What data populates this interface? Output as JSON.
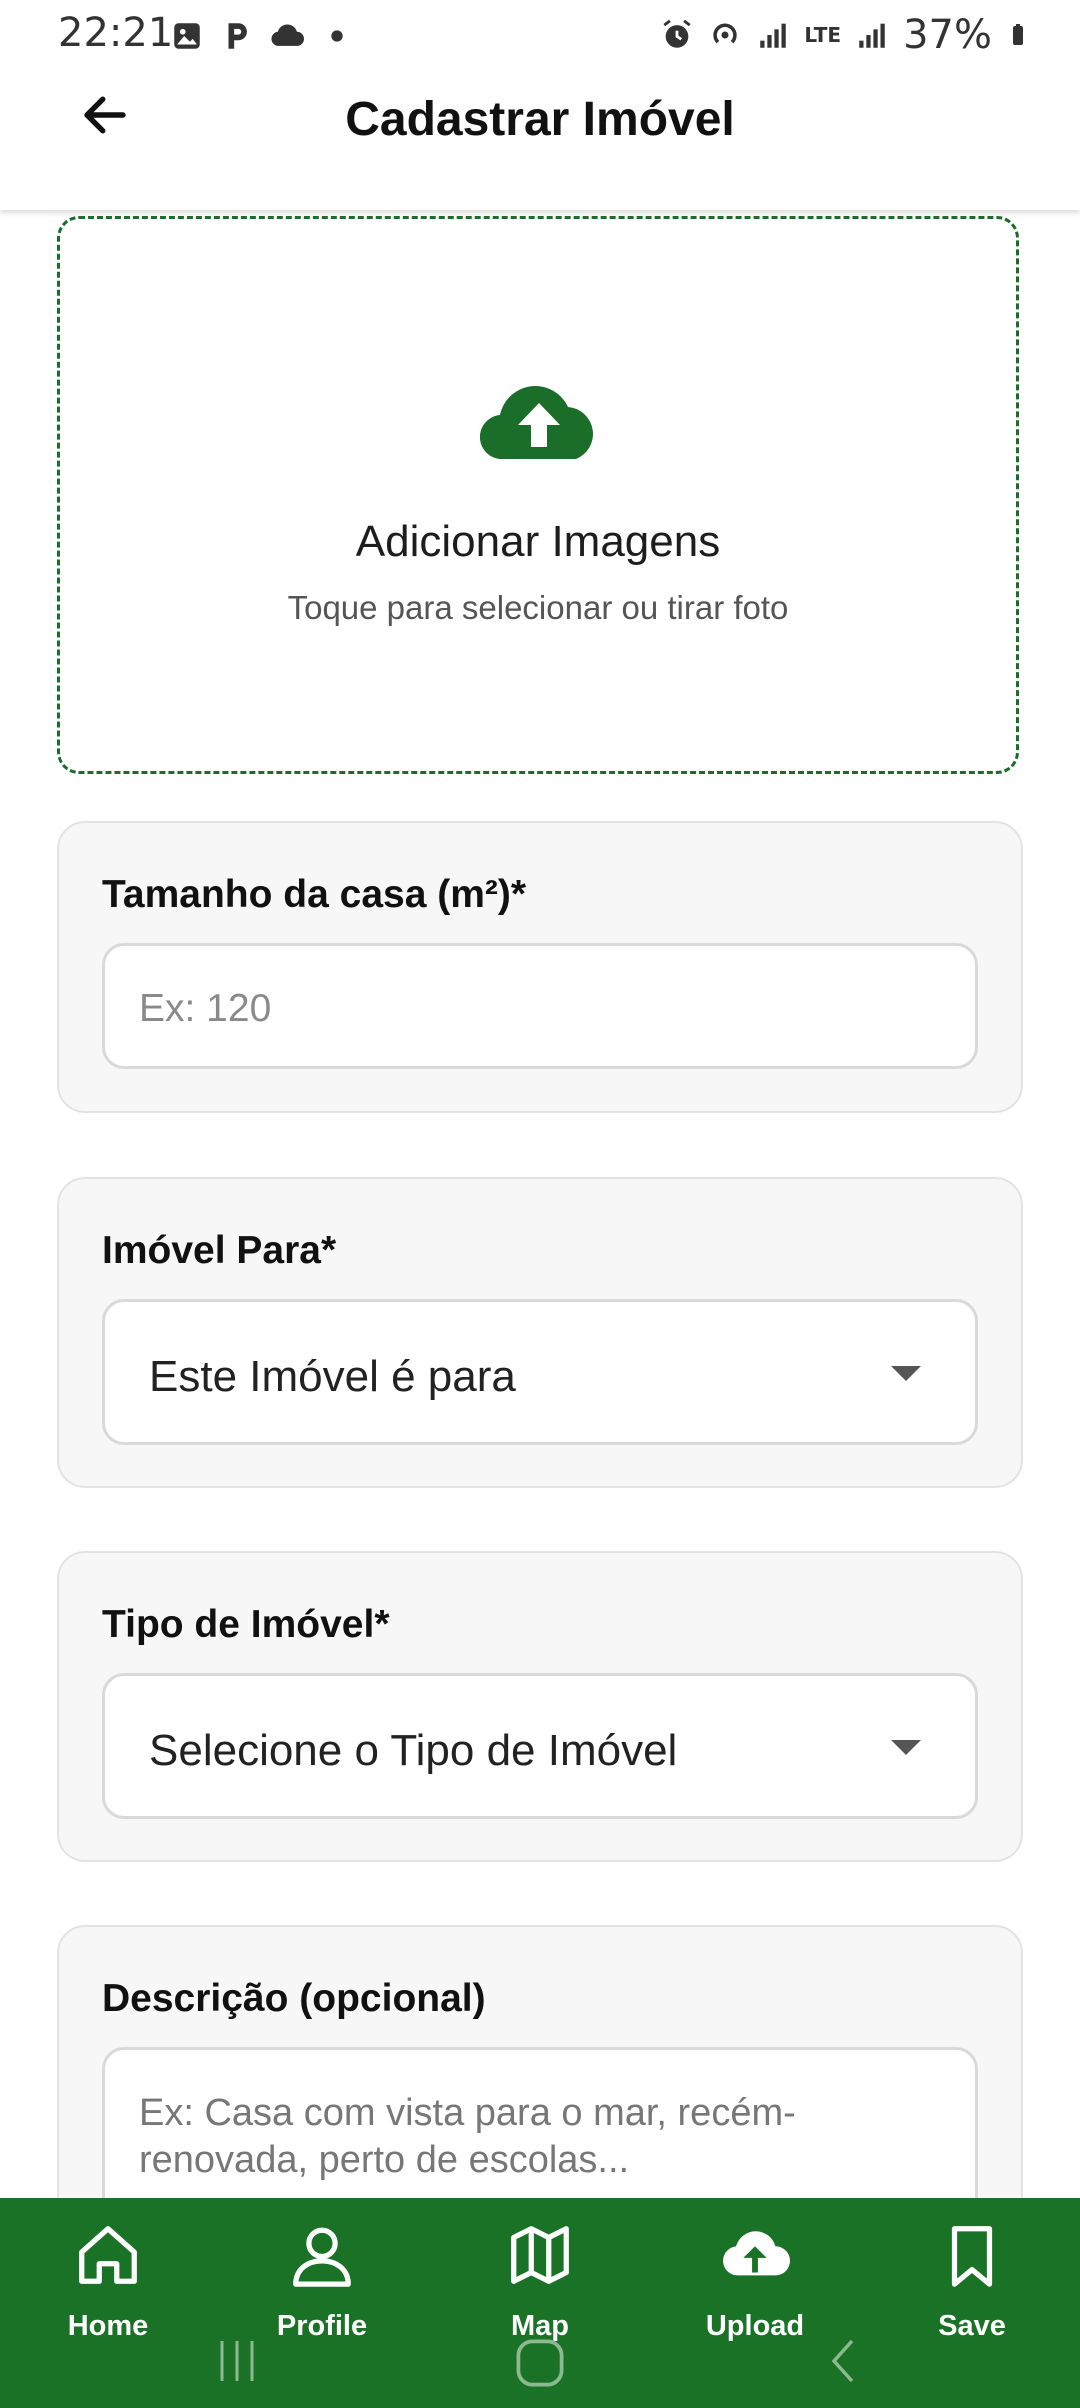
{
  "status_bar": {
    "time": "22:21",
    "battery": "37%",
    "network": "LTE",
    "icons": [
      "image-icon",
      "parking-icon",
      "cloud-icon",
      "dot-icon",
      "alarm-icon",
      "hotspot-icon",
      "signal-icon",
      "signal-icon",
      "battery-icon"
    ]
  },
  "header": {
    "title": "Cadastrar Imóvel",
    "back_icon": "arrow-left-icon"
  },
  "upload": {
    "icon": "cloud-upload-icon",
    "title": "Adicionar Imagens",
    "subtitle": "Toque para selecionar ou tirar foto"
  },
  "form": {
    "size": {
      "label": "Tamanho da casa (m²)*",
      "placeholder": "Ex: 120",
      "value": ""
    },
    "purpose": {
      "label": "Imóvel Para*",
      "selected": "Este Imóvel é para"
    },
    "type": {
      "label": "Tipo de Imóvel*",
      "selected": "Selecione o Tipo de Imóvel"
    },
    "description": {
      "label": "Descrição (opcional)",
      "placeholder": "Ex: Casa com vista para o mar, recém-renovada, perto de escolas..."
    }
  },
  "bottom_nav": {
    "items": [
      {
        "label": "Home",
        "icon": "home-icon"
      },
      {
        "label": "Profile",
        "icon": "person-icon"
      },
      {
        "label": "Map",
        "icon": "map-icon"
      },
      {
        "label": "Upload",
        "icon": "cloud-upload-icon"
      },
      {
        "label": "Save",
        "icon": "bookmark-icon"
      }
    ]
  },
  "colors": {
    "primary": "#1a7226",
    "card_background": "#f7f7f7",
    "card_border": "#e3e3e3"
  }
}
